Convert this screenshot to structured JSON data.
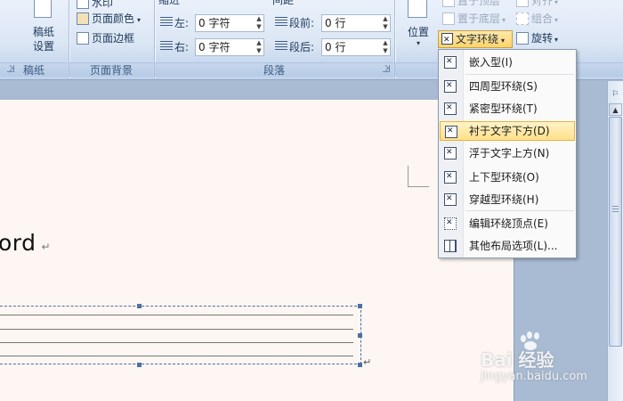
{
  "ribbon": {
    "page_setup": {
      "manuscript_label_1": "稿纸",
      "manuscript_label_2": "设置",
      "group_label": "稿纸"
    },
    "page_background": {
      "watermark_label": "水印",
      "page_color_label": "页面颜色",
      "page_border_label": "页面边框",
      "group_label": "页面背景"
    },
    "paragraph": {
      "indent_header": "缩进",
      "spacing_header": "间距",
      "indent_left_label": "左:",
      "indent_left_value": "0 字符",
      "indent_right_label": "右:",
      "indent_right_value": "0 字符",
      "spacing_before_label": "段前:",
      "spacing_before_value": "0 行",
      "spacing_after_label": "段后:",
      "spacing_after_value": "0 行",
      "group_label": "段落"
    },
    "arrange": {
      "position_label": "位置",
      "bring_front_label": "置于顶层",
      "send_back_label": "置于底层",
      "text_wrap_label": "文字环绕",
      "align_label": "对齐",
      "group_label": "组合",
      "rotate_label": "旋转"
    }
  },
  "document": {
    "visible_text": "ord"
  },
  "wrap_menu": {
    "items": [
      {
        "label": "嵌入型(I)"
      },
      {
        "label": "四周型环绕(S)"
      },
      {
        "label": "紧密型环绕(T)"
      },
      {
        "label": "衬于文字下方(D)"
      },
      {
        "label": "浮于文字上方(N)"
      },
      {
        "label": "上下型环绕(O)"
      },
      {
        "label": "穿越型环绕(H)"
      },
      {
        "label": "编辑环绕顶点(E)"
      },
      {
        "label": "其他布局选项(L)..."
      }
    ],
    "highlighted_index": 3
  },
  "watermark": {
    "logo_text": "Bai  经验",
    "url": "jingyan.baidu.com"
  },
  "colors": {
    "ribbon_bg": "#dbe6f4",
    "highlight": "#ffe08a",
    "page": "#fdf6f2"
  }
}
